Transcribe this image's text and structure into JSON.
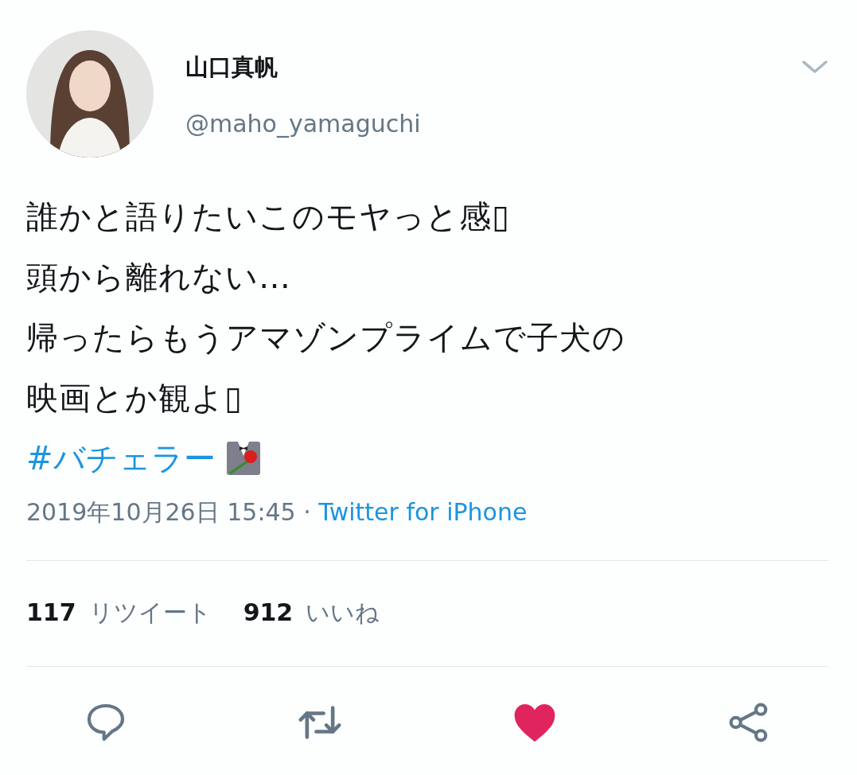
{
  "author": {
    "name": "山口真帆",
    "handle": "@maho_yamaguchi"
  },
  "tweet": {
    "lines": [
      "誰かと語りたいこのモヤっと感▯",
      "頭から離れない…",
      "帰ったらもうアマゾンプライムで子犬の",
      "映画とか観よ▯"
    ],
    "hashtag": "#バチェラー"
  },
  "meta": {
    "timestamp": "2019年10月26日 15:45 · ",
    "source": "Twitter for iPhone"
  },
  "stats": [
    {
      "count": "117",
      "label": "リツイート"
    },
    {
      "count": "912",
      "label": "いいね"
    }
  ],
  "actions": [
    {
      "kind": "reply",
      "on": false
    },
    {
      "kind": "retweet",
      "on": false
    },
    {
      "kind": "like",
      "on": true
    },
    {
      "kind": "share",
      "on": false
    }
  ]
}
